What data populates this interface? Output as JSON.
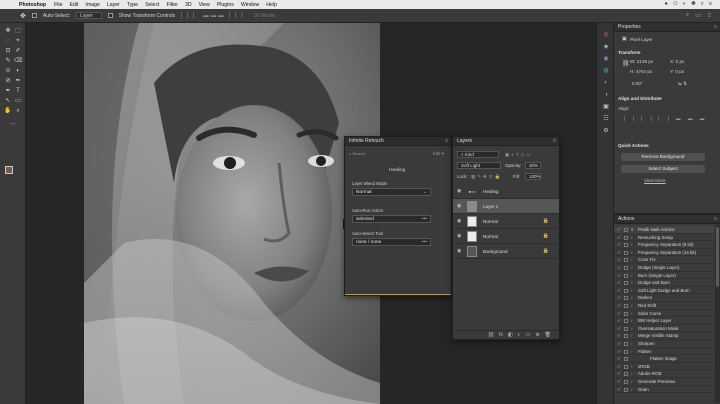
{
  "menubar": {
    "apple": "",
    "app": "Photoshop",
    "items": [
      "File",
      "Edit",
      "Image",
      "Layer",
      "Type",
      "Select",
      "Filter",
      "3D",
      "View",
      "Plugins",
      "Window",
      "Help"
    ],
    "status_icons": [
      "●",
      "⚇",
      "◐",
      "✽",
      "⌕",
      "≡"
    ]
  },
  "options": {
    "tool_glyph": "✥",
    "auto_select_label": "Auto-Select:",
    "auto_select_value": "Layer",
    "transform_label": "Show Transform Controls",
    "align_icons": "▏▏▏ ▬▬▬ ▏▏▏",
    "mode_label": "3D Mode:",
    "right_icons": [
      "⌕",
      "▭",
      "⇪"
    ]
  },
  "toolbar": {
    "tools": [
      "✥",
      "⬚",
      "◌",
      "⌖",
      "⊡",
      "✐",
      "✎",
      "⌫",
      "⊙",
      "◐",
      "⊘",
      "✒",
      "T",
      "↖",
      "▭",
      "✋",
      "⌕",
      "…"
    ]
  },
  "iconstrip": {
    "icons": [
      "◎",
      "◈",
      "◉",
      "◍",
      "◐",
      "◑",
      "▣",
      "☷",
      "⚙"
    ]
  },
  "properties": {
    "title": "Properties",
    "menu": "≡",
    "layer_kind": "Pixel Layer",
    "transform_title": "Transform",
    "w": "W: 3136 px",
    "x": "X: 0 px",
    "h": "H: 4764 px",
    "y": "Y: 0 px",
    "angle": "0.00°",
    "flip": "⇋ ⇅",
    "align_title": "Align and Distribute",
    "align_label": "Align:",
    "quick_title": "Quick Actions",
    "btn_remove_bg": "Remove Background",
    "btn_select_subject": "Select Subject",
    "view_more": "View More"
  },
  "actions": {
    "title": "Actions",
    "menu": "≡",
    "rows": [
      {
        "name": "Pratik Naik Actions",
        "type": "set"
      },
      {
        "name": "Retouching Setup",
        "type": "item"
      },
      {
        "name": "Frequency Separation (8 bit)",
        "type": "item"
      },
      {
        "name": "Frequency Separation (16 bit)",
        "type": "item"
      },
      {
        "name": "Color Fix",
        "type": "item"
      },
      {
        "name": "Dodge (Single Layer)",
        "type": "item"
      },
      {
        "name": "Burn (Single Layer)",
        "type": "item"
      },
      {
        "name": "Dodge and Burn",
        "type": "item"
      },
      {
        "name": "Soft Light Dodge and Burn",
        "type": "item"
      },
      {
        "name": "Darken",
        "type": "item"
      },
      {
        "name": "Red Shift",
        "type": "item"
      },
      {
        "name": "Solar Curve",
        "type": "item"
      },
      {
        "name": "BW Helper Layer",
        "type": "item"
      },
      {
        "name": "Oversaturation Mask",
        "type": "item"
      },
      {
        "name": "Merge Visible Stamp",
        "type": "item"
      },
      {
        "name": "Sharpen",
        "type": "item"
      },
      {
        "name": "Flatten",
        "type": "item"
      },
      {
        "name": "Flatten Image",
        "type": "sub"
      },
      {
        "name": "sRGB",
        "type": "item"
      },
      {
        "name": "Adobe RGB",
        "type": "item"
      },
      {
        "name": "Generate Previews",
        "type": "item"
      },
      {
        "name": "Grain",
        "type": "item"
      }
    ]
  },
  "infinite_retouch": {
    "title": "Infinite Retouch",
    "menu": "≡",
    "search_placeholder": "⌕ Search",
    "edit": "Edit ▾",
    "header": "Healing",
    "blend_label": "Layer Blend Mode",
    "blend_value": "Normal",
    "autorun_label": "Auto-Run Action",
    "autorun_value": "selected",
    "autoselect_label": "Auto-Select Tool",
    "autoselect_value": "none / none",
    "dots": "•••"
  },
  "layers": {
    "title": "Layers",
    "menu": "≡",
    "kind_label": "⌕ Kind",
    "blend": "Soft Light",
    "opacity_label": "Opacity:",
    "opacity_value": "30%",
    "lock_label": "Lock:",
    "fill_label": "Fill:",
    "fill_value": "100%",
    "rows": [
      {
        "name": "Healing",
        "type": "group"
      },
      {
        "name": "Layer 1",
        "type": "layer",
        "selected": true
      },
      {
        "name": "Normal",
        "type": "layer"
      },
      {
        "name": "Normal",
        "type": "layer"
      },
      {
        "name": "Background",
        "type": "bg"
      }
    ],
    "footer_icons": [
      "⛓",
      "fx",
      "◧",
      "◐",
      "▭",
      "⊕",
      "🗑"
    ]
  }
}
